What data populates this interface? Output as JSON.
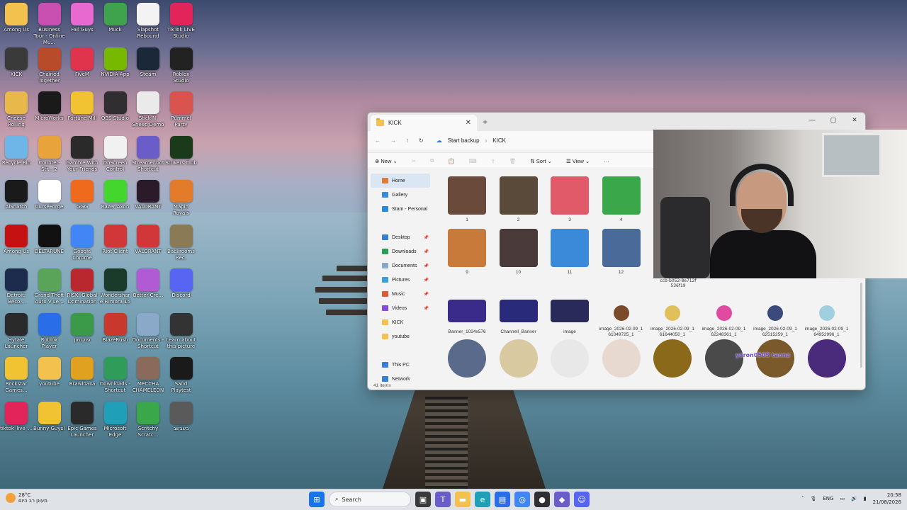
{
  "desktop": {
    "icons": [
      {
        "label": "Among Us",
        "color": "#f2c14e"
      },
      {
        "label": "Business Tour - Online Mu...",
        "color": "#c94fb0"
      },
      {
        "label": "Fall Guys",
        "color": "#e86ad0"
      },
      {
        "label": "Muck",
        "color": "#3fa34d"
      },
      {
        "label": "Slapshot Rebound",
        "color": "#f3f3f3"
      },
      {
        "label": "TikTok LIVE Studio",
        "color": "#e3245b"
      },
      {
        "label": "KICK",
        "color": "#3a3a3a"
      },
      {
        "label": "Chained Together",
        "color": "#b84b2a"
      },
      {
        "label": "FiveM",
        "color": "#e0344c"
      },
      {
        "label": "NVIDIA App",
        "color": "#76b900"
      },
      {
        "label": "Steam",
        "color": "#1b2838"
      },
      {
        "label": "Roblox Studio",
        "color": "#222222"
      },
      {
        "label": "Cheese Rolling",
        "color": "#e8b94a"
      },
      {
        "label": "MicroWorks",
        "color": "#1a1a1a"
      },
      {
        "label": "Fortune Mill",
        "color": "#f1c232"
      },
      {
        "label": "OBS Studio",
        "color": "#302e31"
      },
      {
        "label": "Stick N' Sheep Demo",
        "color": "#eaeaea"
      },
      {
        "label": "Pummel Party",
        "color": "#d9534f"
      },
      {
        "label": "Recycle Bin",
        "color": "#6fb6e8"
      },
      {
        "label": "Counter-Str... 2",
        "color": "#e8a33a"
      },
      {
        "label": "Gamble With Your Friends",
        "color": "#2a2a2a"
      },
      {
        "label": "OnScreen Control",
        "color": "#f1f1f1"
      },
      {
        "label": "Streamer.bot Shortcut",
        "color": "#6a5cc9"
      },
      {
        "label": "Strikers Club",
        "color": "#1a3a1a"
      },
      {
        "label": "AlSnatch",
        "color": "#1a1a1a"
      },
      {
        "label": "CurseForge",
        "color": "#ffffff"
      },
      {
        "label": "GGG",
        "color": "#f06a1d"
      },
      {
        "label": "Razer Axon",
        "color": "#44d62c"
      },
      {
        "label": "VALORANT",
        "color": "#2a1a2a"
      },
      {
        "label": "Mapin Royals",
        "color": "#e27b2a"
      },
      {
        "label": "Among Us",
        "color": "#c51111"
      },
      {
        "label": "DELTARUNE",
        "color": "#111111"
      },
      {
        "label": "Google Chrome",
        "color": "#4285f4"
      },
      {
        "label": "Riot Client",
        "color": "#d13639"
      },
      {
        "label": "VALORANT",
        "color": "#d13639"
      },
      {
        "label": "Backrooms Rec.",
        "color": "#8a7a56"
      },
      {
        "label": "Detroit: Beco...",
        "color": "#1d2c4d"
      },
      {
        "label": "Grand Theft Auto V Le...",
        "color": "#5aa45a"
      },
      {
        "label": "RISK: Global Domination",
        "color": "#b8282e"
      },
      {
        "label": "Wondershare Filmora 15",
        "color": "#1a3a2a"
      },
      {
        "label": "Better-Cre...",
        "color": "#b05ad3"
      },
      {
        "label": "Discord",
        "color": "#5865f2"
      },
      {
        "label": "Hytale Launcher",
        "color": "#2a2a2a"
      },
      {
        "label": "Roblox Player",
        "color": "#2a6de8"
      },
      {
        "label": "פוקנמון",
        "color": "#3a9a4a"
      },
      {
        "label": "BlazeRush",
        "color": "#c9382d"
      },
      {
        "label": "Documents - Shortcut",
        "color": "#8aa8c8"
      },
      {
        "label": "Learn about this picture",
        "color": "#333333"
      },
      {
        "label": "Rockstar Games...",
        "color": "#f1c232"
      },
      {
        "label": "youtube",
        "color": "#f2c14e"
      },
      {
        "label": "Brawlhalla",
        "color": "#e0a020"
      },
      {
        "label": "Downloads - Shortcut",
        "color": "#2f9c5a"
      },
      {
        "label": "MECCHA CHAMELEON",
        "color": "#8a6a5a"
      },
      {
        "label": "Sand Playtest",
        "color": "#1a1a1a"
      },
      {
        "label": "tiktok_live_...",
        "color": "#e3245b"
      },
      {
        "label": "Bunny Guys!",
        "color": "#f1c232"
      },
      {
        "label": "Epic Games Launcher",
        "color": "#2a2a2a"
      },
      {
        "label": "Microsoft Edge",
        "color": "#1fa0b8"
      },
      {
        "label": "Scritchy Scratc...",
        "color": "#3aa84a"
      },
      {
        "label": "בשבשב",
        "color": "#5a5a5a"
      }
    ]
  },
  "explorer": {
    "tab_title": "KICK",
    "breadcrumb": [
      "Start backup",
      "KICK"
    ],
    "toolbar": {
      "new": "New",
      "sort": "Sort",
      "view": "View",
      "more": "···"
    },
    "nav": [
      {
        "label": "Home",
        "color": "#e07b3a",
        "selected": true,
        "pin": false
      },
      {
        "label": "Gallery",
        "color": "#3a8ad9",
        "selected": false,
        "pin": false
      },
      {
        "label": "Stam - Personal",
        "color": "#2a8ae0",
        "selected": false,
        "pin": false
      },
      {
        "label": "Desktop",
        "color": "#3a7fd6",
        "selected": false,
        "pin": true
      },
      {
        "label": "Downloads",
        "color": "#2f9c5a",
        "selected": false,
        "pin": true
      },
      {
        "label": "Documents",
        "color": "#8aa8c8",
        "selected": false,
        "pin": true
      },
      {
        "label": "Pictures",
        "color": "#3aa0d9",
        "selected": false,
        "pin": true
      },
      {
        "label": "Music",
        "color": "#e05a3a",
        "selected": false,
        "pin": true
      },
      {
        "label": "Videos",
        "color": "#8a4ad9",
        "selected": false,
        "pin": true
      },
      {
        "label": "KICK",
        "color": "#f2c14e",
        "selected": false,
        "pin": false
      },
      {
        "label": "youtube",
        "color": "#f2c14e",
        "selected": false,
        "pin": false
      },
      {
        "label": "This PC",
        "color": "#3a7fd6",
        "selected": false,
        "pin": false
      },
      {
        "label": "Network",
        "color": "#3a7fd6",
        "selected": false,
        "pin": false
      }
    ],
    "items": [
      {
        "name": "1",
        "color": "#6a4a3a"
      },
      {
        "name": "2",
        "color": "#5a4a3a"
      },
      {
        "name": "3",
        "color": "#e05a6a"
      },
      {
        "name": "4",
        "color": "#3aa84a"
      },
      {
        "name": "9",
        "color": "#c87a3a"
      },
      {
        "name": "10",
        "color": "#4a3a3a"
      },
      {
        "name": "11",
        "color": "#3a8ad9"
      },
      {
        "name": "12",
        "color": "#4a6a9a"
      },
      {
        "name": "Banner_1024x576",
        "color": "#3a2a8a"
      },
      {
        "name": "Channell_Banner",
        "color": "#2a2a7a"
      },
      {
        "name": "image",
        "color": "#2a2a5a"
      },
      {
        "name": "image_2026-02-09_161049725_1",
        "color": "#7a4a2a"
      },
      {
        "name": "image_2026-02-09_161644050_1",
        "color": "#e0c05a"
      },
      {
        "name": "image_2026-02-09_162248361_1",
        "color": "#e04aa0"
      },
      {
        "name": "image_2026-02-09_162515259_1",
        "color": "#3a4a7a"
      },
      {
        "name": "image_2026-02-09_164952996_1",
        "color": "#a0d0e0"
      },
      {
        "name": "",
        "color": "#5a6a8a"
      },
      {
        "name": "",
        "color": "#d9c9a0"
      },
      {
        "name": "",
        "color": "#e8e8e8"
      },
      {
        "name": "",
        "color": "#e8d9d0"
      },
      {
        "name": "",
        "color": "#8a6a1a"
      },
      {
        "name": "",
        "color": "#4a4a4a"
      },
      {
        "name": "",
        "color": "#7a5a2a"
      },
      {
        "name": "",
        "color": "#4a2a7a"
      }
    ],
    "hover_tooltip": "ccb-b052-8e712f 536f19",
    "status": "41 items"
  },
  "overlay": {
    "stream_text": "yaron050S tanna"
  },
  "taskbar": {
    "weather_temp": "28°C",
    "weather_text": "מעונן רב היום",
    "search_placeholder": "Search",
    "lang": "ENG",
    "time": "20:58",
    "date": "21/08/2026"
  }
}
